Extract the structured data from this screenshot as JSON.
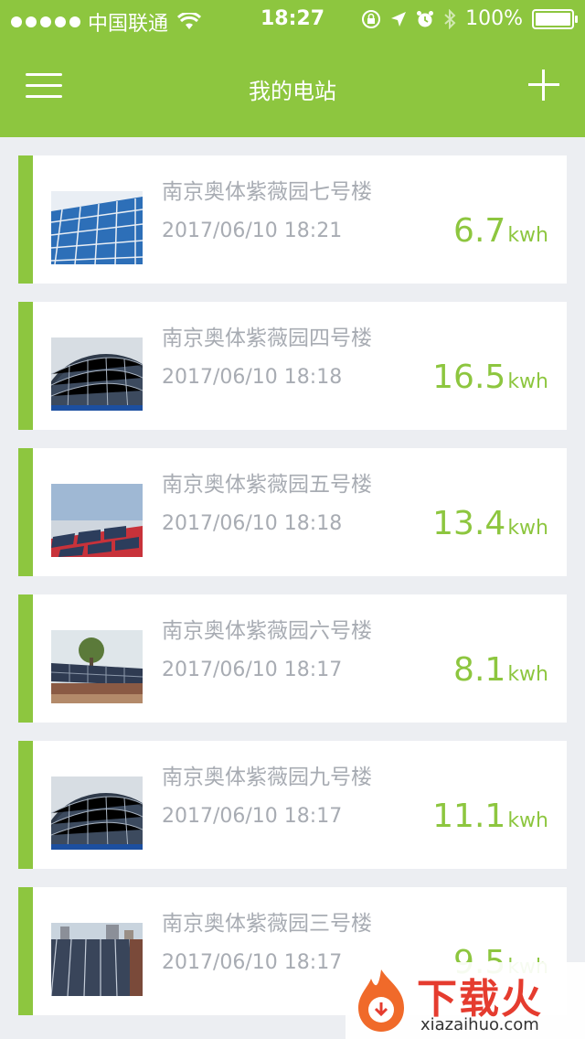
{
  "status_bar": {
    "carrier": "中国联通",
    "time": "18:27",
    "battery": "100%"
  },
  "nav": {
    "title": "我的电站"
  },
  "stations": [
    {
      "name": "南京奥体紫薇园七号楼",
      "time": "2017/06/10 18:21",
      "energy": "6.7",
      "unit": "kwh",
      "thumb": "panels-blue-grid"
    },
    {
      "name": "南京奥体紫薇园四号楼",
      "time": "2017/06/10 18:18",
      "energy": "16.5",
      "unit": "kwh",
      "thumb": "panels-dome"
    },
    {
      "name": "南京奥体紫薇园五号楼",
      "time": "2017/06/10 18:18",
      "energy": "13.4",
      "unit": "kwh",
      "thumb": "panels-red-roof"
    },
    {
      "name": "南京奥体紫薇园六号楼",
      "time": "2017/06/10 18:17",
      "energy": "8.1",
      "unit": "kwh",
      "thumb": "panels-tree-roof"
    },
    {
      "name": "南京奥体紫薇园九号楼",
      "time": "2017/06/10 18:17",
      "energy": "11.1",
      "unit": "kwh",
      "thumb": "panels-dome"
    },
    {
      "name": "南京奥体紫薇园三号楼",
      "time": "2017/06/10 18:17",
      "energy": "9.5",
      "unit": "kwh",
      "thumb": "panels-rows-city"
    }
  ],
  "watermark": {
    "brand": "下载火",
    "url": "xiazaihuo.com"
  },
  "colors": {
    "accent": "#8dc63f",
    "text_muted": "#a8acb3",
    "background": "#eceef2"
  }
}
